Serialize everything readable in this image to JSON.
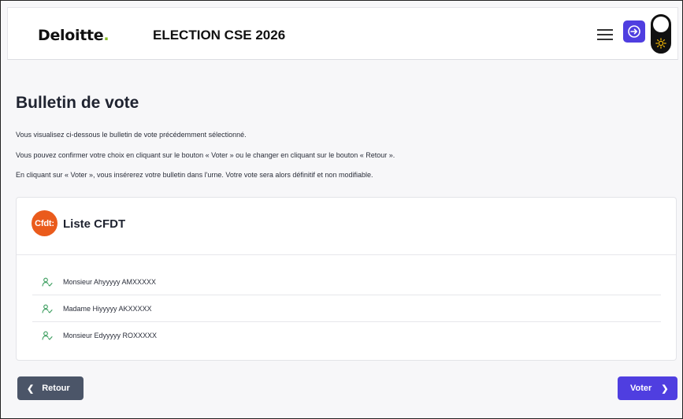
{
  "header": {
    "logo_text": "Deloitte",
    "logo_dot": ".",
    "title": "ELECTION CSE 2026",
    "icons": [
      "menu-icon",
      "login-icon",
      "theme-toggle-icon",
      "sun-icon"
    ],
    "accent": "#4f3ee0",
    "brand_green": "#86bc25"
  },
  "page": {
    "title": "Bulletin de vote",
    "intro": [
      "Vous visualisez ci-dessous le bulletin de vote précédemment sélectionné.",
      "Vous pouvez confirmer votre choix en cliquant sur le bouton « Voter » ou le changer en cliquant sur le bouton « Retour ».",
      "En cliquant sur « Voter », vous insérerez votre bulletin dans l'urne. Votre vote sera alors définitif et non modifiable."
    ]
  },
  "ballot": {
    "logo_text": "Cfdt:",
    "logo_color": "#ea5b1c",
    "list_name": "Liste CFDT",
    "candidates": [
      "Monsieur Ahyyyyy AMXXXXX",
      "Madame Hiyyyyy AKXXXXX",
      "Monsieur Edyyyyy ROXXXXX"
    ]
  },
  "actions": {
    "back_label": "Retour",
    "vote_label": "Voter",
    "back_color": "#4b5568"
  }
}
